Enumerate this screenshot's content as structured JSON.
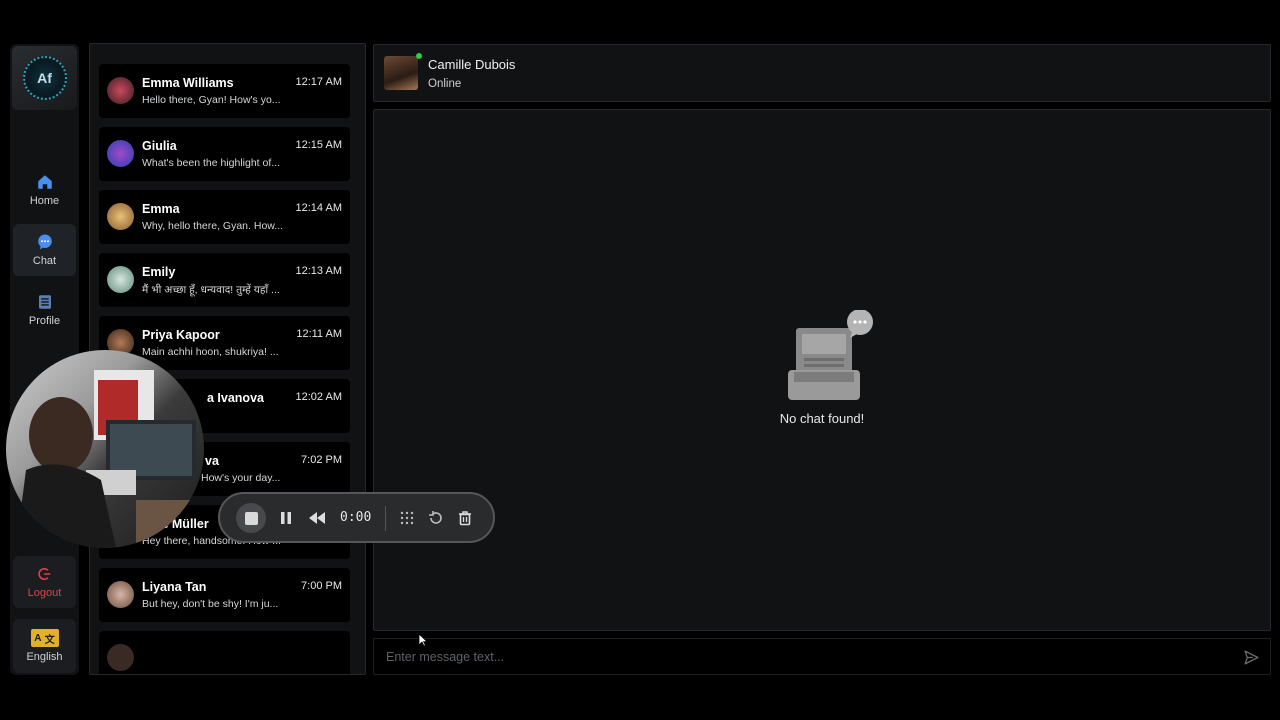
{
  "sidebar": {
    "logo_text": "Af",
    "nav": [
      {
        "label": "Home",
        "icon": "home-icon"
      },
      {
        "label": "Chat",
        "icon": "chat-icon"
      },
      {
        "label": "Profile",
        "icon": "profile-icon"
      }
    ],
    "logout_label": "Logout",
    "language_label": "English"
  },
  "chat_list": [
    {
      "name": "Emma Williams",
      "preview": "Hello there, Gyan! How's yo...",
      "time": "12:17 AM",
      "color": "#c84a5e"
    },
    {
      "name": "Giulia",
      "preview": "What's been the highlight of...",
      "time": "12:15 AM",
      "color": "#6c3fd1"
    },
    {
      "name": "Emma",
      "preview": "Why, hello there, Gyan. How...",
      "time": "12:14 AM",
      "color": "#d8a25a"
    },
    {
      "name": "Emily",
      "preview": "मैं भी अच्छा हूँ, धन्यवाद! तुम्हें यहाँ ...",
      "time": "12:13 AM",
      "color": "#8fb8a8"
    },
    {
      "name": "Priya Kapoor",
      "preview": "Main achhi hoon, shukriya! ...",
      "time": "12:11 AM",
      "color": "#7a4a38"
    },
    {
      "name": "a Ivanova",
      "preview": "",
      "time": "12:02 AM",
      "color": "#3a3a3a"
    },
    {
      "name": "va",
      "preview": "How's your day...",
      "time": "7:02 PM",
      "color": "#3a3a3a"
    },
    {
      "name": "ie Müller",
      "preview": "Hey there, handsome! How ...",
      "time": "",
      "color": "#3a3a3a"
    },
    {
      "name": "Liyana Tan",
      "preview": "But hey, don't be shy! I'm ju...",
      "time": "7:00 PM",
      "color": "#a07c6c"
    }
  ],
  "header": {
    "name": "Camille Dubois",
    "status": "Online"
  },
  "empty_state": {
    "text": "No chat found!"
  },
  "input": {
    "placeholder": "Enter message text..."
  },
  "recorder": {
    "time": "0:00"
  }
}
